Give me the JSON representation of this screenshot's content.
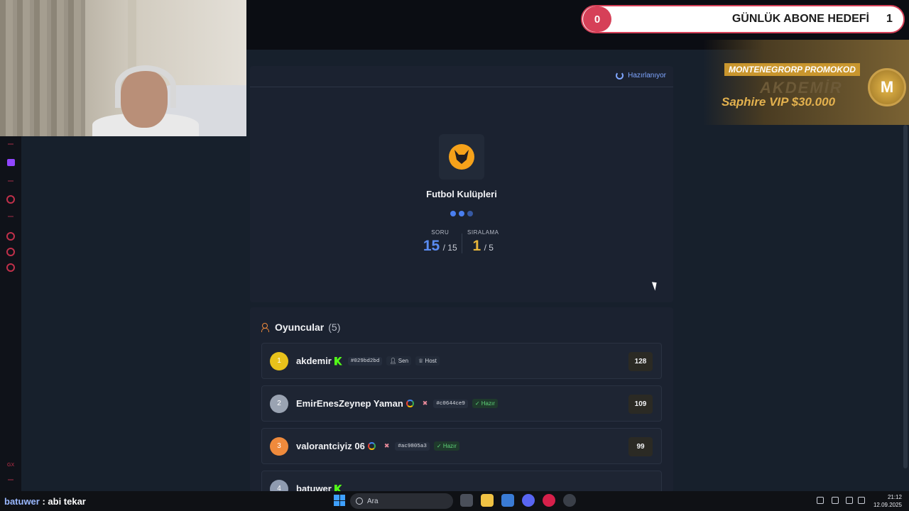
{
  "stream": {
    "sub_goal": {
      "current": "0",
      "title": "GÜNLÜK ABONE HEDEFİ",
      "target": "1"
    },
    "promo": {
      "title": "MONTENEGRORP PROMOKOD",
      "name": "AKDEMİR",
      "vip": "Saphire VIP $30.000",
      "logo": "M"
    },
    "chat": {
      "user": "batuwer",
      "message": " : abi tekar"
    }
  },
  "game": {
    "status": "Hazırlanıyor",
    "category": "Futbol Kulüpleri",
    "stats": {
      "question_label": "SORU",
      "question_current": "15",
      "question_total": "/ 15",
      "rank_label": "SIRALAMA",
      "rank_current": "1",
      "rank_total": "/ 5"
    }
  },
  "players": {
    "title": "Oyuncular",
    "count": "(5)",
    "list": [
      {
        "rank": "1",
        "name": "akdemir",
        "platform": "kick",
        "hash": "#029bd2bd",
        "tags": [
          "Sen",
          "Host"
        ],
        "score": "128",
        "color": "#e8c21b"
      },
      {
        "rank": "2",
        "name": "EmirEnesZeynep Yaman",
        "platform": "google",
        "hash": "#c0644ce9",
        "tags": [
          "Hazır"
        ],
        "score": "109",
        "color": "#9aa3b2"
      },
      {
        "rank": "3",
        "name": "valorantciyiz 06",
        "platform": "google",
        "hash": "#ac9805a3",
        "tags": [
          "Hazır"
        ],
        "score": "99",
        "color": "#ef8a3c"
      },
      {
        "rank": "4",
        "name": "batuwer",
        "platform": "kick",
        "hash": "",
        "tags": [],
        "score": "",
        "color": "#8f9bb0"
      }
    ]
  },
  "taskbar": {
    "search_placeholder": "Ara",
    "time": "21:12",
    "date": "12.09.2025"
  },
  "colors": {
    "accent_blue": "#4a7ff0",
    "accent_gold": "#e8b63a",
    "ready_green": "#5fd47a",
    "alert_red": "#d64058"
  }
}
